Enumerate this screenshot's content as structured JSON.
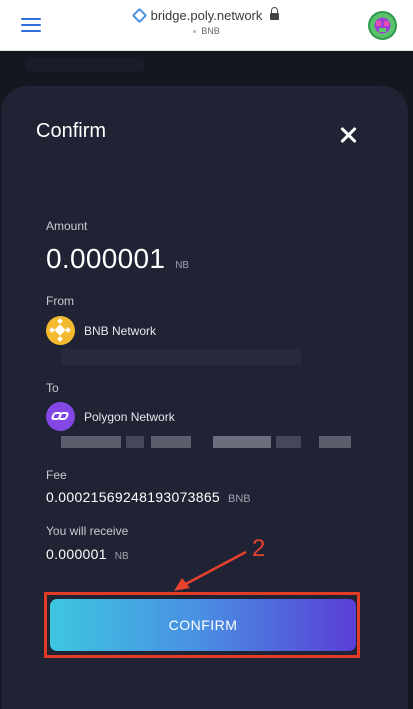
{
  "browser": {
    "url": "bridge.poly.network",
    "subtitle": "BNB"
  },
  "modal": {
    "title": "Confirm",
    "amount_label": "Amount",
    "amount_value": "0.000001",
    "amount_unit": "NB",
    "from_label": "From",
    "from_network": "BNB Network",
    "to_label": "To",
    "to_network": "Polygon Network",
    "fee_label": "Fee",
    "fee_value": "0.00021569248193073865",
    "fee_unit": "BNB",
    "receive_label": "You will receive",
    "receive_value": "0.000001",
    "receive_unit": "NB",
    "confirm_label": "CONFIRM"
  },
  "annotation": {
    "step_number": "2",
    "color": "#e8412e"
  },
  "colors": {
    "modal_bg": "#1f2333",
    "page_bg": "#14171f",
    "button_gradient_start": "#3ec6e0",
    "button_gradient_end": "#5a3fd6",
    "bnb": "#f3ba2f",
    "polygon": "#8247e5"
  },
  "icons": {
    "menu": "hamburger-menu-icon",
    "site": "site-icon",
    "lock": "lock-icon",
    "avatar": "user-avatar",
    "close": "close-icon",
    "from_network": "bnb-icon",
    "to_network": "polygon-icon",
    "annotation_arrow": "arrow-icon"
  }
}
